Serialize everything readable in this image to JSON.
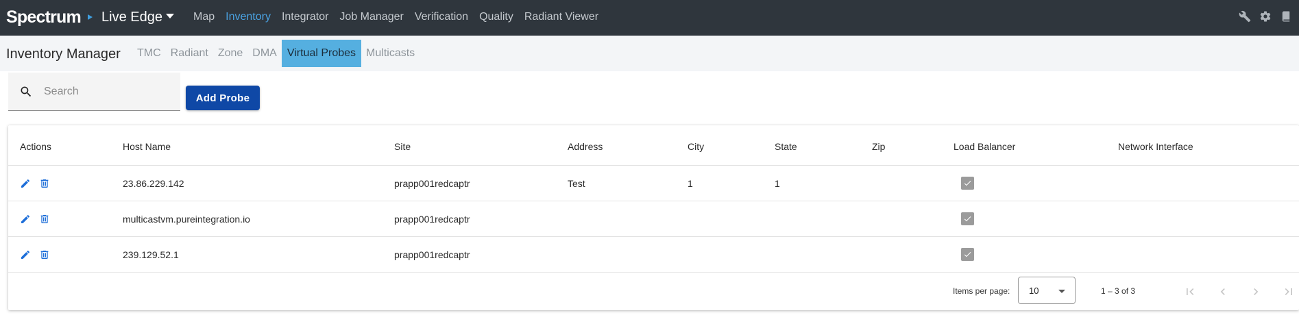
{
  "app": {
    "brand": "Spectrum",
    "environment": "Live Edge",
    "nav": [
      {
        "label": "Map",
        "active": false
      },
      {
        "label": "Inventory",
        "active": true
      },
      {
        "label": "Integrator",
        "active": false
      },
      {
        "label": "Job Manager",
        "active": false
      },
      {
        "label": "Verification",
        "active": false
      },
      {
        "label": "Quality",
        "active": false
      },
      {
        "label": "Radiant Viewer",
        "active": false
      }
    ],
    "tools": [
      "wrench-icon",
      "gear-icon",
      "book-icon"
    ],
    "colors": {
      "topbar": "#2f363d",
      "accent": "#4aa3e3",
      "primary_button": "#0f48a6",
      "active_subtab": "#55afe0"
    }
  },
  "subnav": {
    "title": "Inventory Manager",
    "tabs": [
      {
        "label": "TMC",
        "active": false
      },
      {
        "label": "Radiant",
        "active": false
      },
      {
        "label": "Zone",
        "active": false
      },
      {
        "label": "DMA",
        "active": false
      },
      {
        "label": "Virtual Probes",
        "active": true
      },
      {
        "label": "Multicasts",
        "active": false
      }
    ]
  },
  "search": {
    "placeholder": "Search",
    "value": ""
  },
  "add_button": {
    "label": "Add Probe"
  },
  "table": {
    "columns": {
      "actions": "Actions",
      "host": "Host Name",
      "site": "Site",
      "address": "Address",
      "city": "City",
      "state": "State",
      "zip": "Zip",
      "load_balancer": "Load Balancer",
      "network_interface": "Network Interface"
    },
    "rows": [
      {
        "host": "23.86.229.142",
        "site": "prapp001redcaptr",
        "address": "Test",
        "city": "1",
        "state": "1",
        "zip": "",
        "load_balancer": true,
        "network_interface": ""
      },
      {
        "host": "multicastvm.pureintegration.io",
        "site": "prapp001redcaptr",
        "address": "",
        "city": "",
        "state": "",
        "zip": "",
        "load_balancer": true,
        "network_interface": ""
      },
      {
        "host": "239.129.52.1",
        "site": "prapp001redcaptr",
        "address": "",
        "city": "",
        "state": "",
        "zip": "",
        "load_balancer": true,
        "network_interface": ""
      }
    ]
  },
  "paginator": {
    "items_per_page_label": "Items per page:",
    "items_per_page": "10",
    "range": "1 – 3 of 3"
  }
}
